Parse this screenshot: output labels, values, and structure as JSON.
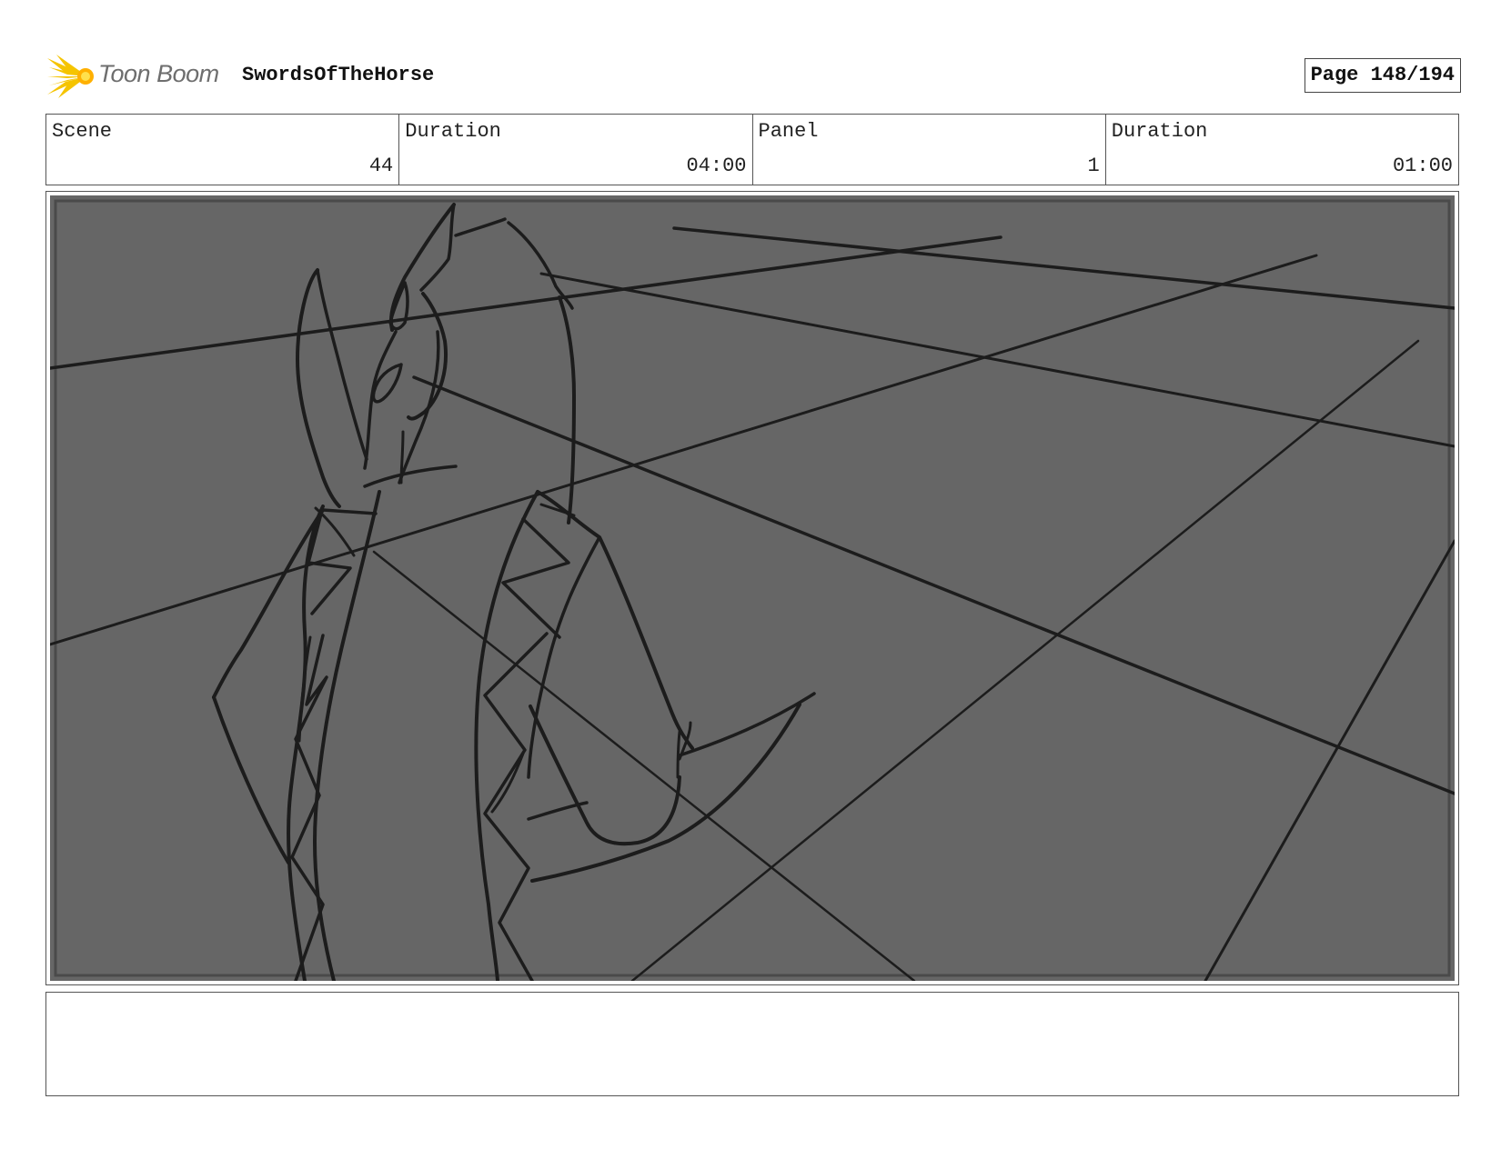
{
  "brand": {
    "logo_text": "Toon Boom",
    "logo_icon": "starburst-icon",
    "accent_color": "#F5C400"
  },
  "project": {
    "title": "SwordsOfTheHorse"
  },
  "page": {
    "label": "Page 148/194"
  },
  "info": {
    "scene_label": "Scene",
    "scene_value": "44",
    "scene_duration_label": "Duration",
    "scene_duration_value": "04:00",
    "panel_label": "Panel",
    "panel_value": "1",
    "panel_duration_label": "Duration",
    "panel_duration_value": "01:00"
  },
  "panel_image": {
    "background_color": "#666666",
    "line_color": "#1c1c1c",
    "description_icon": "storyboard-sketch"
  },
  "notes": {
    "text": ""
  }
}
